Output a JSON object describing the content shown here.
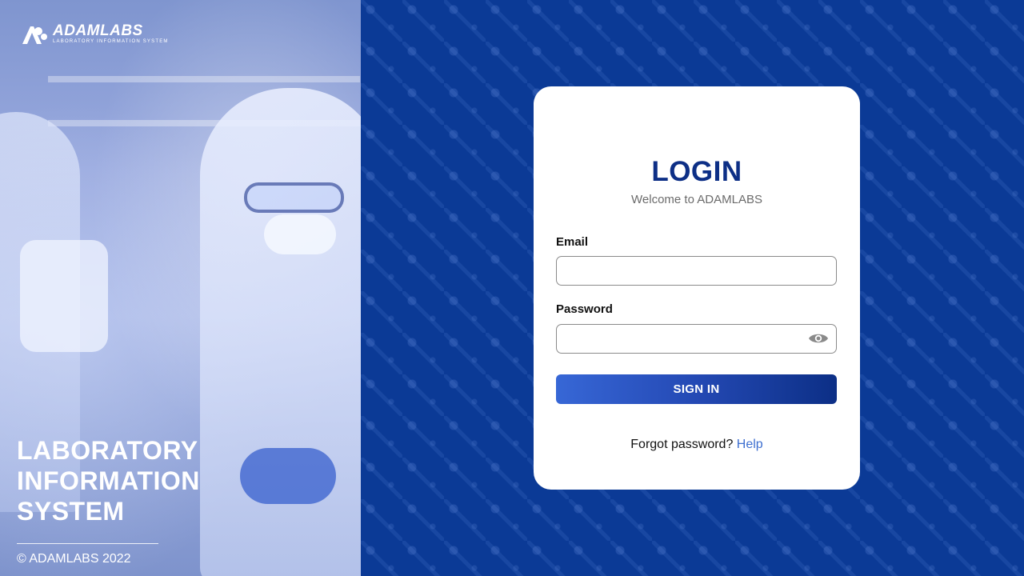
{
  "brand": {
    "name": "ADAMLABS",
    "tagline": "LABORATORY INFORMATION SYSTEM"
  },
  "hero": {
    "lines": [
      "LABORATORY",
      "INFORMATION",
      "SYSTEM"
    ]
  },
  "footer": {
    "copyright": "© ADAMLABS 2022"
  },
  "login": {
    "title": "LOGIN",
    "subtitle": "Welcome to ADAMLABS",
    "email_label": "Email",
    "email_value": "",
    "password_label": "Password",
    "password_value": "",
    "submit_label": "SIGN IN",
    "forgot_text": "Forgot password?",
    "help_link": "Help"
  },
  "icons": {
    "password_toggle": "eye-icon",
    "logo": "adamlabs-logo-icon"
  },
  "colors": {
    "primary": "#0d2f86",
    "background": "#0b3a96",
    "link": "#3e6fd0",
    "button_start": "#3767d6",
    "button_end": "#0c2f86"
  }
}
